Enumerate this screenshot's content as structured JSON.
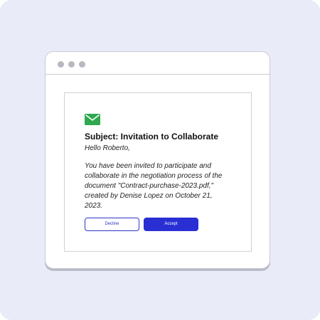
{
  "window": {
    "controls": [
      "dot",
      "dot",
      "dot"
    ]
  },
  "email": {
    "icon": "envelope-icon",
    "icon_color": "#2fa84f",
    "subject": "Subject: Invitation to Collaborate",
    "greeting": "Hello Roberto,",
    "body_lines": [
      "You have been invited to participate and",
      "collaborate in the negotiation process of the",
      "document \"Contract-purchase-2023.pdf,\"",
      "created by Denise Lopez on October 21,",
      "2023."
    ],
    "decline_label": "Decline",
    "accept_label": "Accept"
  },
  "colors": {
    "background": "#e9ecf8",
    "accent": "#2a2fd4",
    "window_border": "#c9cbd3"
  }
}
